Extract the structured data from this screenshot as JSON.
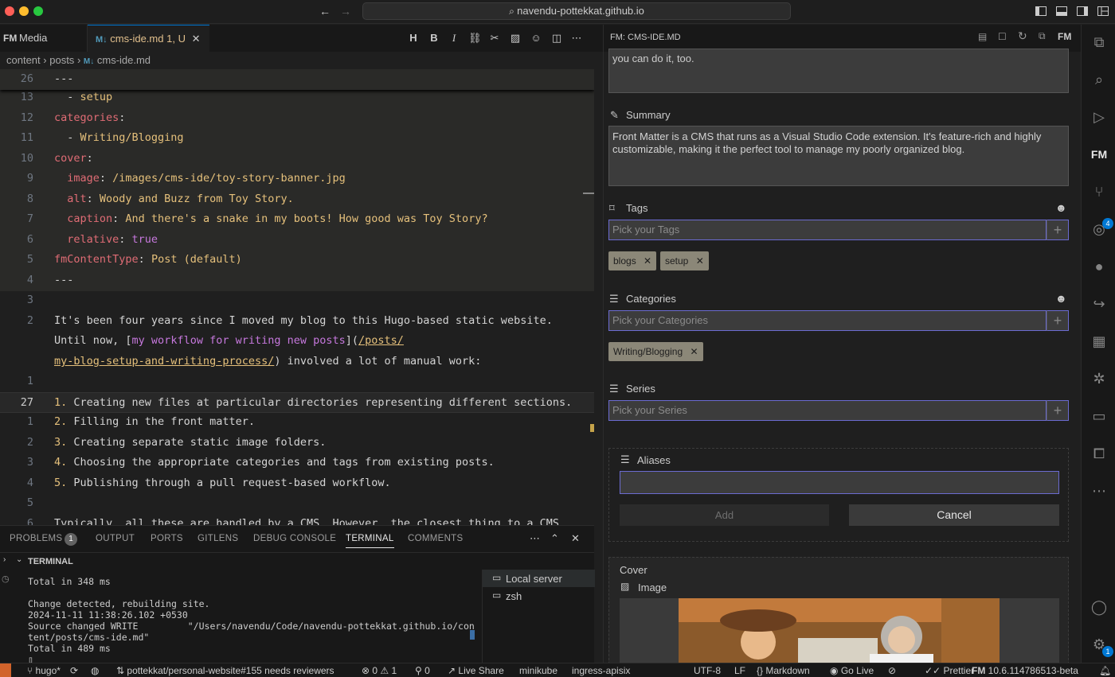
{
  "titlebar": {
    "url": "navendu-pottekkat.github.io"
  },
  "tabs": {
    "media": "Media",
    "cms_file": "cms-ide.md",
    "cms_badge": "1, U"
  },
  "breadcrumb": [
    "content",
    "posts",
    "cms-ide.md"
  ],
  "editor": {
    "line_numbers": [
      "26",
      "13",
      "12",
      "11",
      "10",
      "9",
      "8",
      "7",
      "6",
      "5",
      "4",
      "3",
      "2",
      "",
      "",
      "1",
      "27",
      "1",
      "2",
      "3",
      "4",
      "5",
      "6"
    ],
    "lines": {
      "l0": "---",
      "l1a": "  - ",
      "l1b": "setup",
      "l2a": "categories",
      "l2b": ":",
      "l3a": "  - ",
      "l3b": "Writing/Blogging",
      "l4a": "cover",
      "l4b": ":",
      "l5a": "  image",
      "l5b": ": ",
      "l5c": "/images/cms-ide/toy-story-banner.jpg",
      "l6a": "  alt",
      "l6b": ": ",
      "l6c": "Woody and Buzz from Toy Story.",
      "l7a": "  caption",
      "l7b": ": ",
      "l7c": "And there's a snake in my boots! How good was Toy Story?",
      "l8a": "  relative",
      "l8b": ": ",
      "l8c": "true",
      "l9a": "fmContentType",
      "l9b": ": ",
      "l9c": "Post (default)",
      "l10": "---",
      "p1": "It's been four years since I moved my blog to this Hugo-based static website.",
      "p2a": "Until now, [",
      "p2b": "my workflow for writing new posts",
      "p2c": "](",
      "p2d": "/posts/",
      "p3a": "my-blog-setup-and-writing-process/",
      "p3b": ") involved a lot of manual work:",
      "li1n": "1.",
      "li1": " Creating new files at particular directories representing different sections.",
      "li2n": "2.",
      "li2": " Filling in the front matter.",
      "li3n": "3.",
      "li3": " Creating separate static image folders.",
      "li4n": "4.",
      "li4": " Choosing the appropriate categories and tags from existing posts.",
      "li5n": "5.",
      "li5": " Publishing through a pull request-based workflow.",
      "last": "Typically, all these are handled by a CMS. However, the closest thing to a CMS"
    }
  },
  "panel": {
    "tabs": [
      "PROBLEMS",
      "OUTPUT",
      "PORTS",
      "GITLENS",
      "DEBUG CONSOLE",
      "TERMINAL",
      "COMMENTS"
    ],
    "problems_count": "1",
    "terminal_header": "TERMINAL",
    "terminal_lines": "Total in 348 ms\n\nChange detected, rebuilding site.\n2024-11-11 11:38:26.102 +0530\nSource changed WRITE         \"/Users/navendu/Code/navendu-pottekkat.github.io/con\ntent/posts/cms-ide.md\"\nTotal in 489 ms\n▯",
    "terminals": [
      "Local server",
      "zsh"
    ]
  },
  "fm": {
    "header": "FM: CMS-IDE.MD",
    "desc_tail": "you can do it, too.",
    "summary_label": "Summary",
    "summary_text": "Front Matter is a CMS that runs as a Visual Studio Code extension. It's feature-rich and highly customizable, making it the perfect tool to manage my poorly organized blog.",
    "tags_label": "Tags",
    "tags_placeholder": "Pick your Tags",
    "tags": [
      "blogs",
      "setup"
    ],
    "categories_label": "Categories",
    "categories_placeholder": "Pick your Categories",
    "categories": [
      "Writing/Blogging"
    ],
    "series_label": "Series",
    "series_placeholder": "Pick your Series",
    "aliases_label": "Aliases",
    "add_label": "Add",
    "cancel_label": "Cancel",
    "cover_label": "Cover",
    "image_label": "Image"
  },
  "activity": {
    "scm_badge": "4",
    "settings_badge": "1"
  },
  "status": {
    "branch": "hugo*",
    "pr": "pottekkat/personal-website#155 needs reviewers",
    "errors": "0",
    "warnings": "1",
    "ports": "0",
    "live_share": "Live Share",
    "minikube": "minikube",
    "ingress": "ingress-apisix",
    "encoding": "UTF-8",
    "eol": "LF",
    "language": "Markdown",
    "go_live": "Go Live",
    "prettier": "Prettier",
    "fm_version": "10.6.114786513-beta"
  }
}
